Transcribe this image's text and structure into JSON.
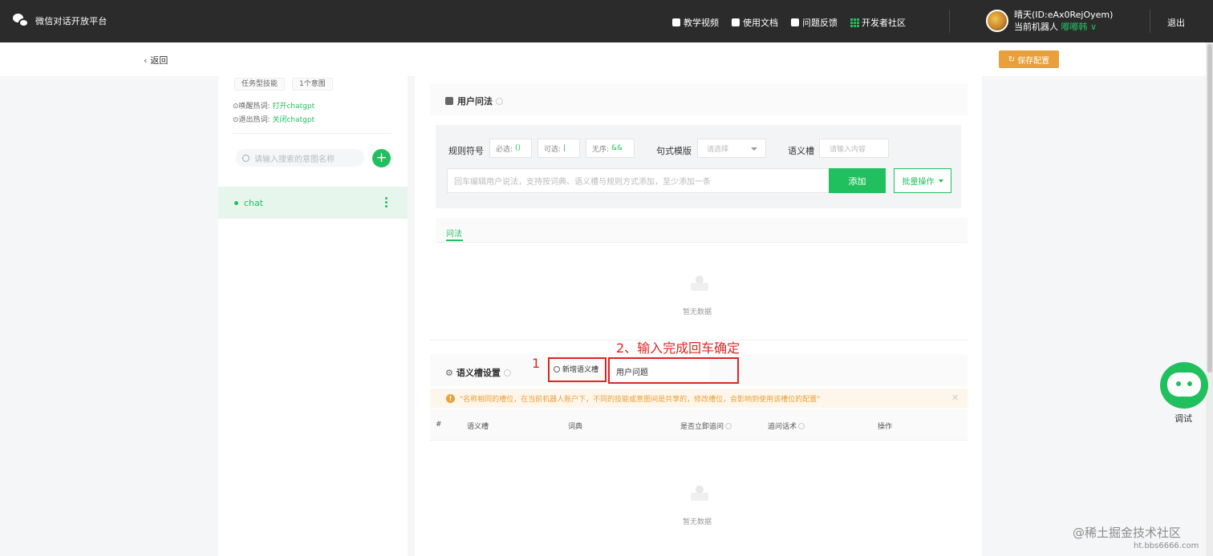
{
  "app": {
    "title": "微信对话开放平台"
  },
  "nav": [
    {
      "label": "教学视频",
      "icon": "video-icon"
    },
    {
      "label": "使用文档",
      "icon": "doc-icon"
    },
    {
      "label": "问题反馈",
      "icon": "feedback-icon"
    },
    {
      "label": "开发者社区",
      "icon": "community-grid-icon"
    }
  ],
  "user": {
    "name": "晴天(ID:eAx0RejOyem)",
    "robot_prefix": "当前机器人",
    "robot_name": "嘟嘟韩",
    "logout": "退出"
  },
  "subheader": {
    "back": "返回",
    "save": "保存配置"
  },
  "left": {
    "tags": [
      "任务型技能",
      "1个意图"
    ],
    "wake_label": "唤醒热词:",
    "wake_value": "打开chatgpt",
    "exit_label": "退出热词:",
    "exit_value": "关闭chatgpt",
    "search_placeholder": "请输入搜索的意图名称",
    "intent": "chat"
  },
  "utterance": {
    "title": "用户问法",
    "rule_label": "规则符号",
    "chips": [
      {
        "label": "必选:",
        "symbol": "()"
      },
      {
        "label": "可选:",
        "symbol": "|"
      },
      {
        "label": "无序:",
        "symbol": "&&"
      }
    ],
    "pattern_label": "句式模版",
    "pattern_placeholder": "请选择",
    "slot_label": "语义槽",
    "slot_placeholder": "请输入内容",
    "input_placeholder": "回车编辑用户说法，支持按词典、语义槽与规则方式添加，至少添加一条",
    "add_button": "添加",
    "batch_button": "批量操作",
    "tab": "问法",
    "empty": "暂无数据"
  },
  "slots": {
    "title": "语义槽设置",
    "new_button": "新增语义槽",
    "name_input_value": "用户问题",
    "warning": "\"名称相同的槽位，在当前机器人账户下，不同的技能或意图间是共享的，修改槽位，会影响到使用该槽位的配置\"",
    "columns": [
      "#",
      "语义槽",
      "词典",
      "是否立即追问",
      "追问话术",
      "操作"
    ],
    "empty": "暂无数据"
  },
  "annotations": {
    "step1": "1",
    "step2": "2、输入完成回车确定"
  },
  "debug": {
    "label": "调试"
  },
  "watermark": {
    "line1": "@稀土掘金技术社区",
    "line2": "ht.bbs6666.com"
  },
  "colors": {
    "accent": "#21c05e",
    "warning": "#e8a03c",
    "annotation": "#e02424",
    "topbar": "#2b2b2c"
  }
}
